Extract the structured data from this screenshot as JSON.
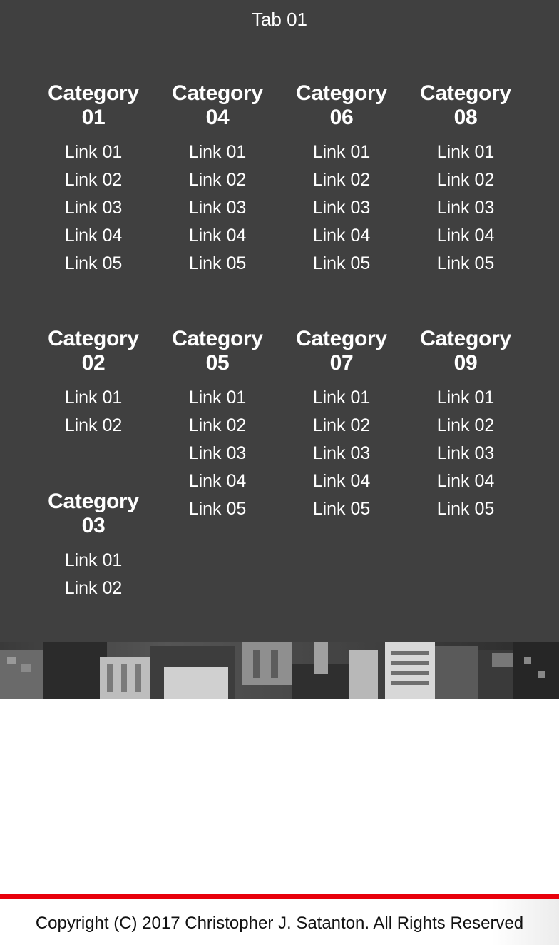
{
  "menu": {
    "tab_label": "Tab 01",
    "categories": [
      {
        "title": "Category\n01",
        "links": [
          "Link 01",
          "Link 02",
          "Link 03",
          "Link 04",
          "Link 05"
        ]
      },
      {
        "title": "Category\n02",
        "links": [
          "Link 01",
          "Link 02"
        ]
      },
      {
        "title": "Category\n03",
        "links": [
          "Link 01",
          "Link 02"
        ]
      },
      {
        "title": "Category\n04",
        "links": [
          "Link 01",
          "Link 02",
          "Link 03",
          "Link 04",
          "Link 05"
        ]
      },
      {
        "title": "Category\n05",
        "links": [
          "Link 01",
          "Link 02",
          "Link 03",
          "Link 04",
          "Link 05"
        ]
      },
      {
        "title": "Category\n06",
        "links": [
          "Link 01",
          "Link 02",
          "Link 03",
          "Link 04",
          "Link 05"
        ]
      },
      {
        "title": "Category\n07",
        "links": [
          "Link 01",
          "Link 02",
          "Link 03",
          "Link 04",
          "Link 05"
        ]
      },
      {
        "title": "Category\n08",
        "links": [
          "Link 01",
          "Link 02",
          "Link 03",
          "Link 04",
          "Link 05"
        ]
      },
      {
        "title": "Category\n09",
        "links": [
          "Link 01",
          "Link 02",
          "Link 03",
          "Link 04",
          "Link 05"
        ]
      }
    ]
  },
  "footer": {
    "copyright": "Copyright (C) 2017 Christopher J. Satanton. All Rights Reserved"
  },
  "colors": {
    "menu_background": "#404040",
    "accent_line": "#e8000b"
  }
}
